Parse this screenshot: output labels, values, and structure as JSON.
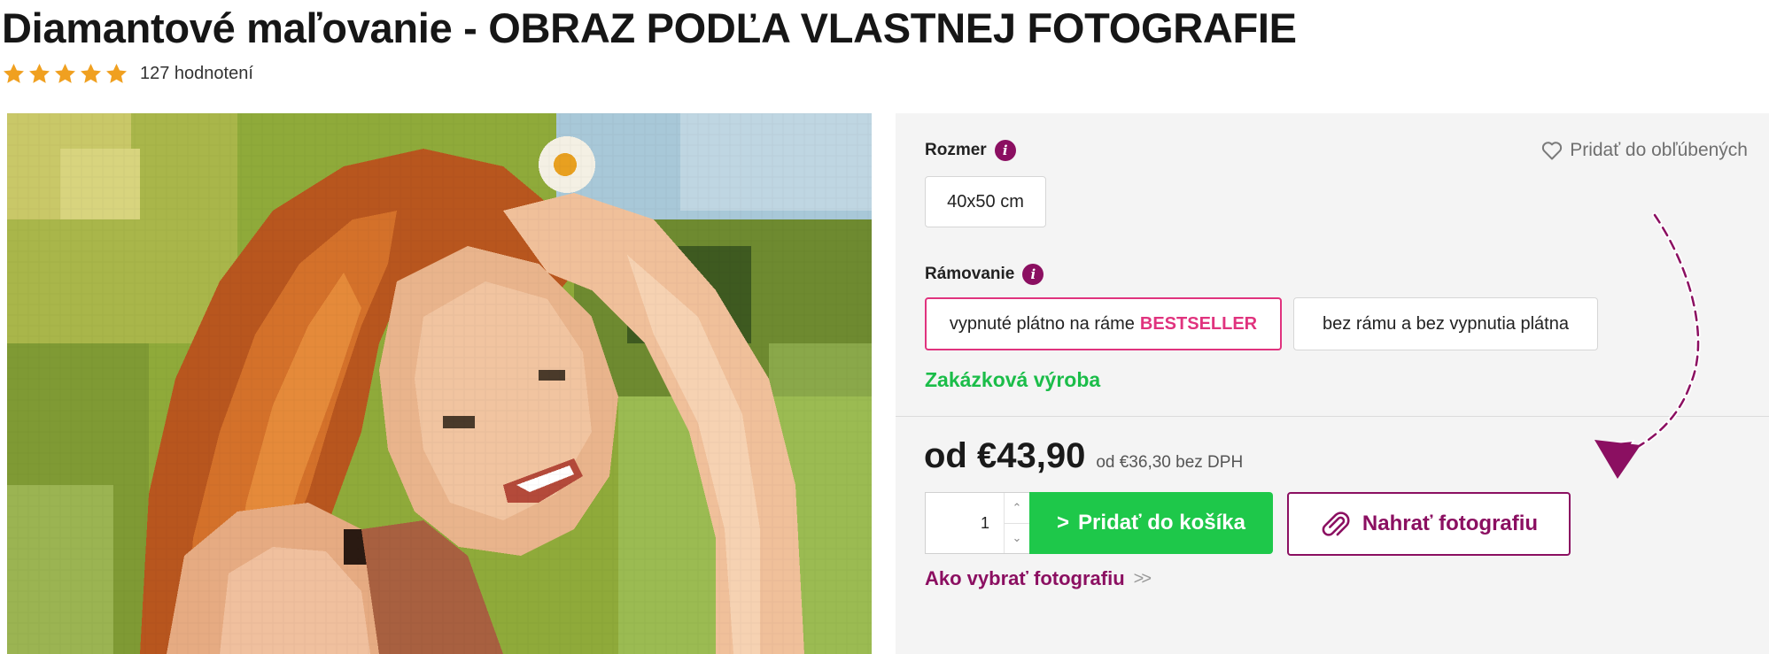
{
  "title": "Diamantové maľovanie - OBRAZ PODĽA VLASTNEJ FOTOGRAFIE",
  "rating": {
    "stars": 5,
    "max_stars": 5,
    "count_label": "127 hodnotení"
  },
  "colors": {
    "accent": "#8b0f61",
    "highlight": "#e0337e",
    "success": "#1ec84a",
    "star": "#f0a020"
  },
  "options": {
    "size": {
      "label": "Rozmer",
      "values": [
        "40x50 cm"
      ]
    },
    "framing": {
      "label": "Rámovanie",
      "values": [
        {
          "text": "vypnuté plátno na ráme",
          "badge": "BESTSELLER",
          "selected": true
        },
        {
          "text": "bez rámu a bez vypnutia plátna",
          "badge": "",
          "selected": false
        }
      ]
    }
  },
  "favorite": {
    "label": "Pridať do obľúbených",
    "icon": "heart-outline-icon"
  },
  "custom_made": "Zakázková výroba",
  "price": {
    "main": "od €43,90",
    "without_vat": "od €36,30 bez DPH"
  },
  "quantity": {
    "value": "1"
  },
  "buttons": {
    "add_to_cart": "Pridať do košíka",
    "upload_photo": "Nahrať fotografiu",
    "how_to_choose": "Ako vybrať fotografiu",
    "how_to_choose_chevron": ">>"
  },
  "icons": {
    "info": "i",
    "cart_chevron": ">"
  }
}
